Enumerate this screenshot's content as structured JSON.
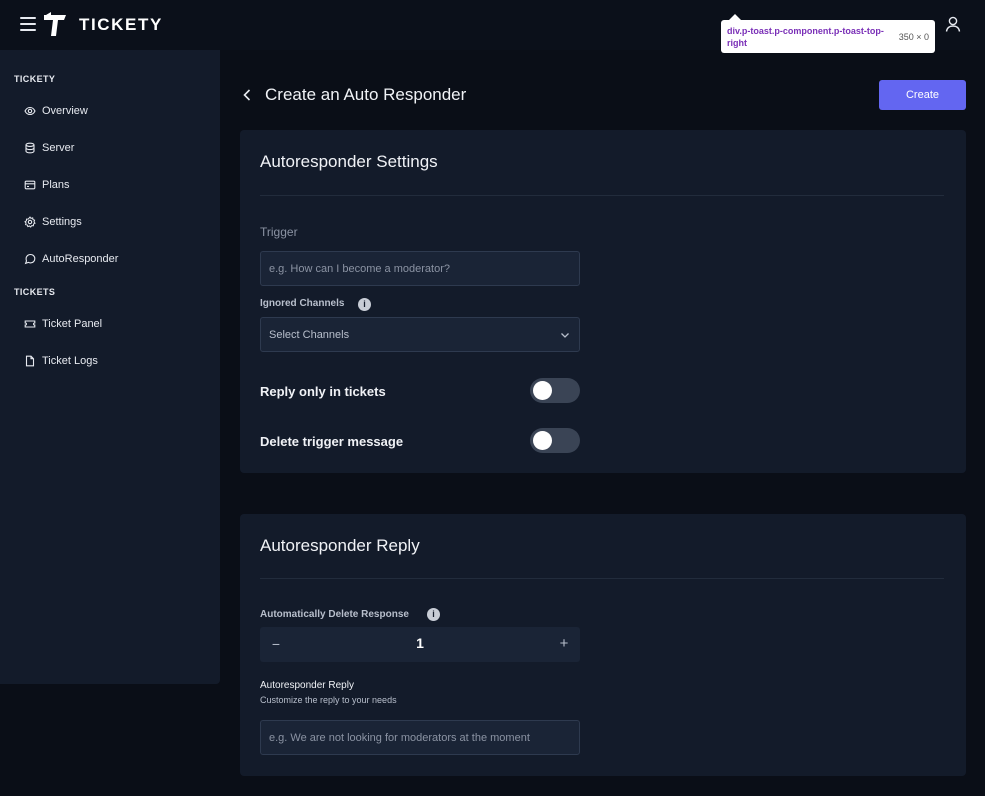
{
  "brand": {
    "name": "TICKETY"
  },
  "tooltip": {
    "selector": "div.p-toast.p-component.p-toast-top-right",
    "dims": "350 × 0"
  },
  "sidebar": {
    "sections": [
      {
        "title": "TICKETY",
        "items": [
          {
            "label": "Overview",
            "icon": "eye-icon"
          },
          {
            "label": "Server",
            "icon": "database-icon"
          },
          {
            "label": "Plans",
            "icon": "card-icon"
          },
          {
            "label": "Settings",
            "icon": "gear-icon"
          },
          {
            "label": "AutoResponder",
            "icon": "chat-icon"
          }
        ]
      },
      {
        "title": "TICKETS",
        "items": [
          {
            "label": "Ticket Panel",
            "icon": "ticket-icon"
          },
          {
            "label": "Ticket Logs",
            "icon": "file-icon"
          }
        ]
      }
    ]
  },
  "page": {
    "title": "Create an Auto Responder",
    "create_label": "Create"
  },
  "settings_card": {
    "title": "Autoresponder Settings",
    "trigger_label": "Trigger",
    "trigger_placeholder": "e.g. How can I become a moderator?",
    "ignored_channels_label": "Ignored Channels",
    "ignored_channels_value": "Select Channels",
    "reply_only_label": "Reply only in tickets",
    "reply_only_on": false,
    "delete_trigger_label": "Delete trigger message",
    "delete_trigger_on": false
  },
  "reply_card": {
    "title": "Autoresponder Reply",
    "auto_delete_label": "Automatically Delete Response",
    "stepper_minus": "−",
    "stepper_value": "1",
    "stepper_plus": "+",
    "reply_label": "Autoresponder Reply",
    "reply_help": "Customize the reply to your needs",
    "reply_placeholder": "e.g. We are not looking for moderators at the moment"
  },
  "info_glyph": "i"
}
